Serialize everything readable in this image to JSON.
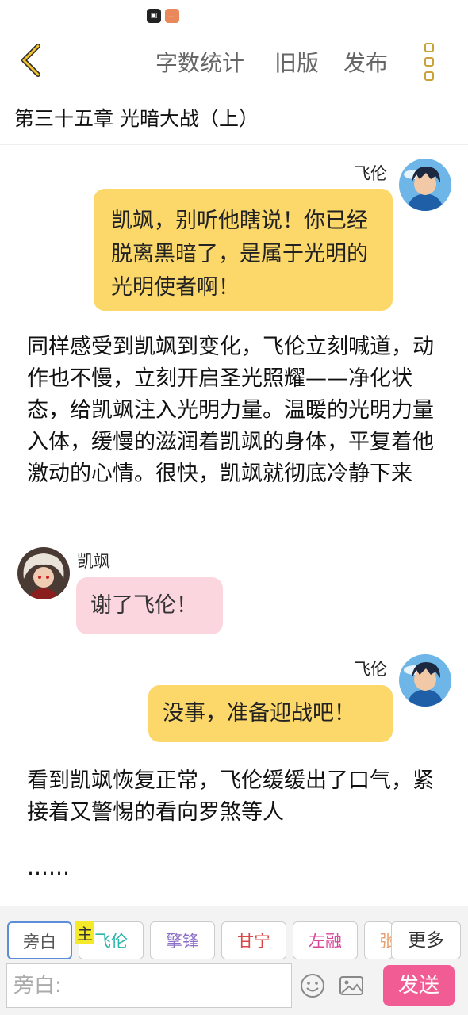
{
  "toolbar": {
    "word_count": "字数统计",
    "old_version": "旧版",
    "publish": "发布"
  },
  "chapter_title": "第三十五章 光暗大战（上）",
  "messages": [
    {
      "speaker": "飞伦",
      "text": "凯飒，别听他瞎说！你已经脱离黑暗了，是属于光明的光明使者啊！"
    },
    {
      "narration": "同样感受到凯飒到变化，飞伦立刻喊道，动作也不慢，立刻开启圣光照耀——净化状态，给凯飒注入光明力量。温暖的光明力量入体，缓慢的滋润着凯飒的身体，平复着他激动的心情。很快，凯飒就彻底冷静下来"
    },
    {
      "speaker": "凯飒",
      "text": "谢了飞伦！"
    },
    {
      "speaker": "飞伦",
      "text": "没事，准备迎战吧！"
    },
    {
      "narration": "看到凯飒恢复正常，飞伦缓缓出了口气，紧接着又警惕的看向罗煞等人"
    },
    {
      "narration": "……"
    }
  ],
  "roles": [
    {
      "label": "旁白",
      "color": "#555555"
    },
    {
      "label": "飞伦",
      "color": "#2bb5a8"
    },
    {
      "label": "擎锋",
      "color": "#8b6fc6"
    },
    {
      "label": "甘宁",
      "color": "#d84848"
    },
    {
      "label": "左融",
      "color": "#d9469a"
    },
    {
      "label": "张",
      "color": "#e8a070"
    }
  ],
  "main_tag": "主",
  "more_roles": "更多",
  "input": {
    "placeholder": "旁白:"
  },
  "send": "发送",
  "colors": {
    "accent_pink": "#f25c94",
    "bubble_yellow": "#fcd86b",
    "bubble_pink": "#fcd6de"
  }
}
